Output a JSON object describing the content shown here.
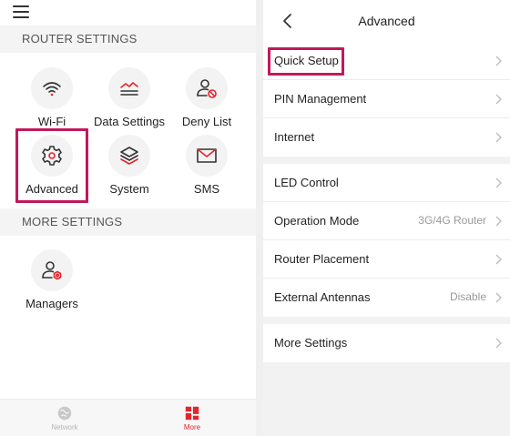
{
  "left": {
    "router_settings_header": "ROUTER SETTINGS",
    "more_settings_header": "MORE SETTINGS",
    "tiles": {
      "wifi": "Wi-Fi",
      "data_settings": "Data Settings",
      "deny_list": "Deny List",
      "advanced": "Advanced",
      "system": "System",
      "sms": "SMS",
      "managers": "Managers"
    },
    "tabs": {
      "network": "Network",
      "more": "More"
    }
  },
  "right": {
    "title": "Advanced",
    "rows": {
      "quick_setup": "Quick Setup",
      "pin_management": "PIN Management",
      "internet": "Internet",
      "led_control": "LED Control",
      "operation_mode": "Operation Mode",
      "operation_mode_value": "3G/4G Router",
      "router_placement": "Router Placement",
      "external_antennas": "External Antennas",
      "external_antennas_value": "Disable",
      "more_settings": "More Settings"
    }
  },
  "colors": {
    "accent": "#e3262d",
    "highlight": "#c2185b",
    "icon": "#333333",
    "inactive_tab": "#b5b5b5"
  }
}
